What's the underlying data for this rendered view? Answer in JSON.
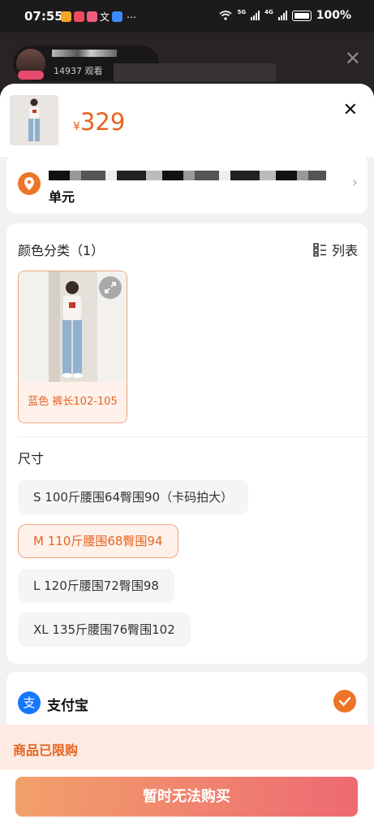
{
  "status_bar": {
    "time": "07:55",
    "dots": "⋯",
    "net_a": "5G",
    "net_b": "4G",
    "battery": "100%"
  },
  "live": {
    "viewers": "14937 观看"
  },
  "product": {
    "currency": "¥",
    "price": "329"
  },
  "address": {
    "line2": "单元"
  },
  "spec": {
    "color_title": "颜色分类（1）",
    "list_toggle": "列表",
    "color_option": "蓝色 裤长102-105",
    "size_title": "尺寸",
    "sizes": [
      "S 100斤腰围64臀围90（卡码拍大）",
      "M 110斤腰围68臀围94",
      "L 120斤腰围72臀围98",
      "XL 135斤腰围76臀围102"
    ],
    "selected_size_index": 1
  },
  "payment": {
    "method": "支付宝",
    "selected": true
  },
  "limit_notice": "商品已限购",
  "buy_button": "暂时无法购买",
  "colors": {
    "accent": "#e8631f",
    "selected_bg": "#fdf1ea",
    "alipay_blue": "#1677ff",
    "button_gradient_start": "#f2a16b",
    "button_gradient_end": "#ee6a72"
  }
}
